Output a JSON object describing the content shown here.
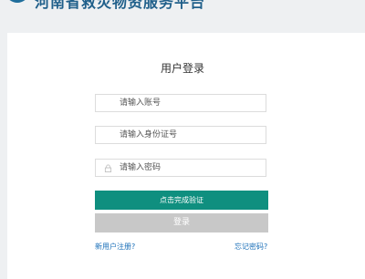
{
  "header": {
    "site_title": "河南省救灾物资服务平台",
    "logo_icon": "shield-logo"
  },
  "login": {
    "title": "用户登录",
    "account_placeholder": "请输入账号",
    "id_placeholder": "请输入身份证号",
    "password_placeholder": "请输入密码",
    "verify_label": "点击完成验证",
    "login_label": "登录",
    "register_link": "新用户注册?",
    "forgot_link": "忘记密码?"
  },
  "colors": {
    "verify_button": "#0f8f7f",
    "login_button_disabled": "#c8c8c8",
    "link": "#1a6fb8"
  }
}
